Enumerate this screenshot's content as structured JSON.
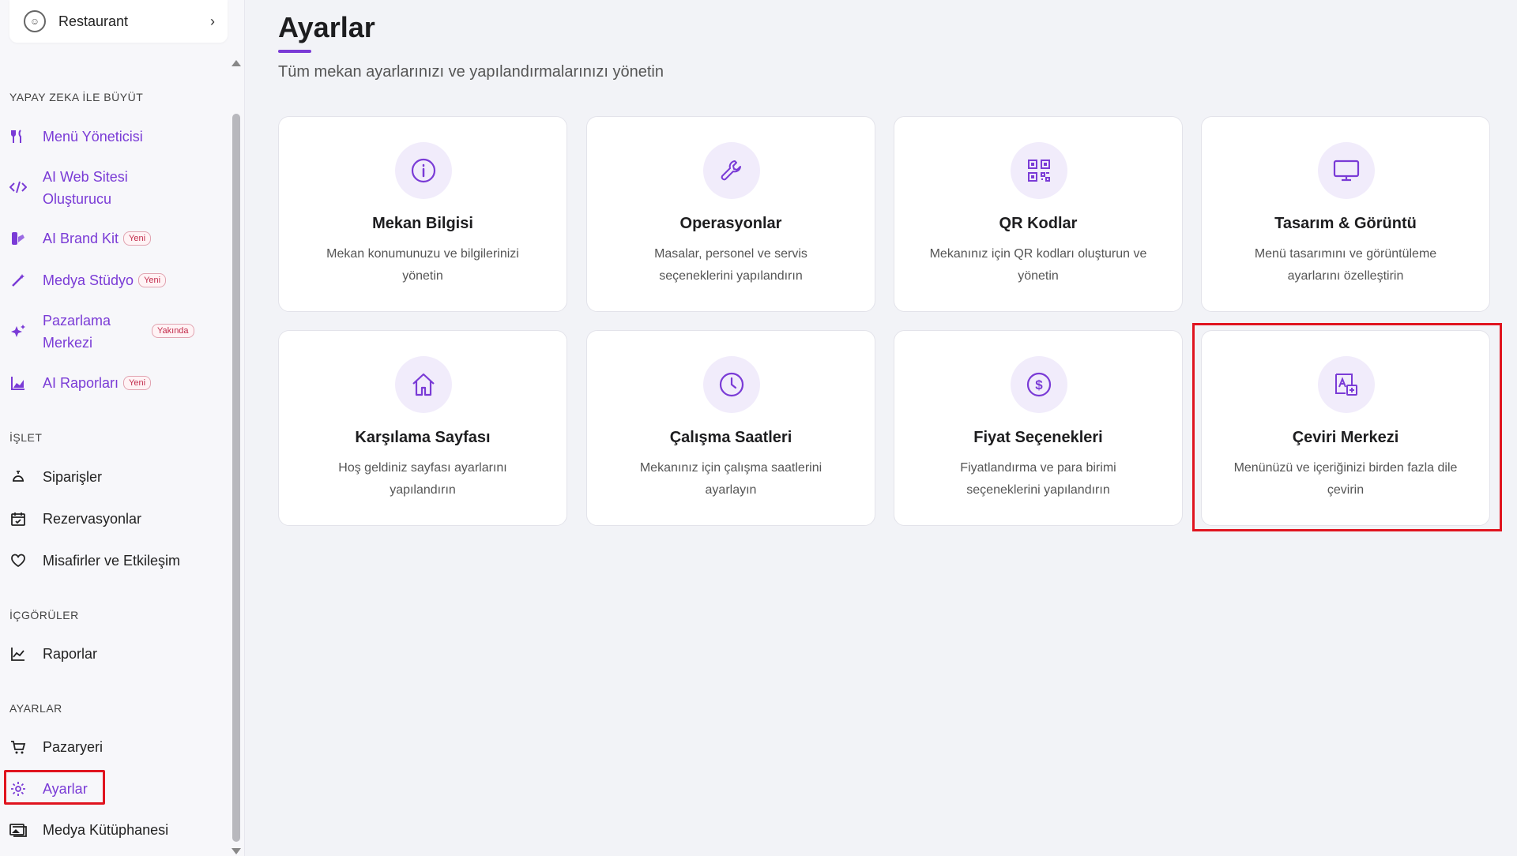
{
  "venue": {
    "name": "Restaurant"
  },
  "sidebar": {
    "sections": [
      {
        "title": "YAPAY ZEKA İLE BÜYÜT"
      },
      {
        "title": "İŞLET"
      },
      {
        "title": "İÇGÖRÜLER"
      },
      {
        "title": "AYARLAR"
      }
    ],
    "items": [
      {
        "label": "Menü Yöneticisi",
        "icon": "fork-knife-icon"
      },
      {
        "label": "AI Web Sitesi",
        "label2": "Oluşturucu",
        "icon": "code-icon"
      },
      {
        "label": "AI Brand Kit",
        "badge": "Yeni",
        "icon": "palette-icon"
      },
      {
        "label": "Medya Stüdyo",
        "badge": "Yeni",
        "icon": "magic-wand-icon"
      },
      {
        "label": "Pazarlama",
        "label2": "Merkezi",
        "badge": "Yakında",
        "icon": "sparkles-icon"
      },
      {
        "label": "AI Raporları",
        "badge": "Yeni",
        "icon": "chart-icon"
      },
      {
        "label": "Siparişler",
        "icon": "bell-icon"
      },
      {
        "label": "Rezervasyonlar",
        "icon": "calendar-icon"
      },
      {
        "label": "Misafirler ve Etkileşim",
        "icon": "heart-icon"
      },
      {
        "label": "Raporlar",
        "icon": "line-chart-icon"
      },
      {
        "label": "Pazaryeri",
        "icon": "cart-icon"
      },
      {
        "label": "Ayarlar",
        "icon": "gear-icon",
        "active": true
      },
      {
        "label": "Medya Kütüphanesi",
        "icon": "images-icon"
      }
    ]
  },
  "page": {
    "title": "Ayarlar",
    "subtitle": "Tüm mekan ayarlarınızı ve yapılandırmalarınızı yönetin"
  },
  "cards": [
    {
      "title": "Mekan Bilgisi",
      "desc": "Mekan konumunuzu ve bilgilerinizi yönetin",
      "icon": "info-icon"
    },
    {
      "title": "Operasyonlar",
      "desc": "Masalar, personel ve servis seçeneklerini yapılandırın",
      "icon": "wrench-icon"
    },
    {
      "title": "QR Kodlar",
      "desc": "Mekanınız için QR kodları oluşturun ve yönetin",
      "icon": "qr-code-icon"
    },
    {
      "title": "Tasarım & Görüntü",
      "desc": "Menü tasarımını ve görüntüleme ayarlarını özelleştirin",
      "icon": "monitor-icon"
    },
    {
      "title": "Karşılama Sayfası",
      "desc": "Hoş geldiniz sayfası ayarlarını yapılandırın",
      "icon": "home-icon"
    },
    {
      "title": "Çalışma Saatleri",
      "desc": "Mekanınız için çalışma saatlerini ayarlayın",
      "icon": "clock-icon"
    },
    {
      "title": "Fiyat Seçenekleri",
      "desc": "Fiyatlandırma ve para birimi seçeneklerini yapılandırın",
      "icon": "dollar-icon"
    },
    {
      "title": "Çeviri Merkezi",
      "desc": "Menünüzü ve içeriğinizi birden fazla dile çevirin",
      "icon": "translate-icon"
    }
  ],
  "colors": {
    "accent": "#7a3bd6",
    "highlight": "#e0141f",
    "iconBg": "#f1ecfb"
  }
}
